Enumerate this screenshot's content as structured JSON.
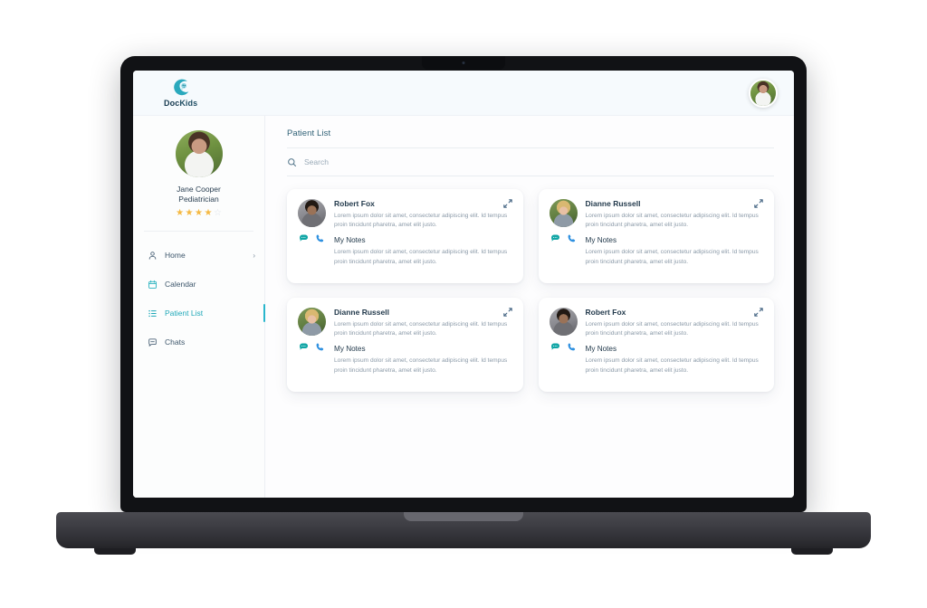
{
  "app": {
    "logo": {
      "icon": "dockids-logo-icon",
      "text_primary": "Doc",
      "text_secondary": "Kids"
    },
    "header_avatar_icon": "user-avatar"
  },
  "sidebar": {
    "profile": {
      "avatar_icon": "doctor-avatar",
      "name": "Jane Cooper",
      "role": "Pediatrician",
      "rating": 4,
      "rating_max": 5
    },
    "items": [
      {
        "label": "Home",
        "icon": "user-outline-icon",
        "active": false,
        "chevron": "›"
      },
      {
        "label": "Calendar",
        "icon": "calendar-icon",
        "active": false
      },
      {
        "label": "Patient List",
        "icon": "list-icon",
        "active": true
      },
      {
        "label": "Chats",
        "icon": "chat-icon",
        "active": false
      }
    ]
  },
  "main": {
    "page_title": "Patient List",
    "search": {
      "icon": "search-icon",
      "placeholder": "Search",
      "value": ""
    },
    "notes_label": "My Notes",
    "lorem": "Lorem ipsum dolor sit amet, consectetur adipiscing elit. Id tempus proin tincidunt pharetra, amet elit justo.",
    "cards": [
      {
        "name": "Robert Fox",
        "avatar": "robert",
        "description": "Lorem ipsum dolor sit amet, consectetur adipiscing elit. Id tempus proin tincidunt pharetra, amet elit justo.",
        "notes_title": "My Notes",
        "notes": "Lorem ipsum dolor sit amet, consectetur adipiscing elit. Id tempus proin tincidunt pharetra, amet elit justo."
      },
      {
        "name": "Dianne Russell",
        "avatar": "dianne",
        "description": "Lorem ipsum dolor sit amet, consectetur adipiscing elit. Id tempus proin tincidunt pharetra, amet elit justo.",
        "notes_title": "My Notes",
        "notes": "Lorem ipsum dolor sit amet, consectetur adipiscing elit. Id tempus proin tincidunt pharetra, amet elit justo."
      },
      {
        "name": "Dianne Russell",
        "avatar": "dianne",
        "description": "Lorem ipsum dolor sit amet, consectetur adipiscing elit. Id tempus proin tincidunt pharetra, amet elit justo.",
        "notes_title": "My Notes",
        "notes": "Lorem ipsum dolor sit amet, consectetur adipiscing elit. Id tempus proin tincidunt pharetra, amet elit justo."
      },
      {
        "name": "Robert Fox",
        "avatar": "robert",
        "description": "Lorem ipsum dolor sit amet, consectetur adipiscing elit. Id tempus proin tincidunt pharetra, amet elit justo.",
        "notes_title": "My Notes",
        "notes": "Lorem ipsum dolor sit amet, consectetur adipiscing elit. Id tempus proin tincidunt pharetra, amet elit justo."
      }
    ],
    "card_action_icons": [
      "chat-bubble-icon",
      "phone-icon"
    ],
    "card_expand_icon": "expand-icon"
  },
  "colors": {
    "accent_teal": "#29b6cc",
    "title_teal": "#2f6075",
    "phone_blue": "#2e90e0",
    "chat_teal": "#11a6a6",
    "star_gold": "#f5b942",
    "star_empty": "#dfe4ea",
    "text_dark": "#243b4d",
    "text_muted": "#8b9aa8"
  },
  "device": {
    "type": "laptop-mockup",
    "camera_icon": "webcam-dot"
  }
}
